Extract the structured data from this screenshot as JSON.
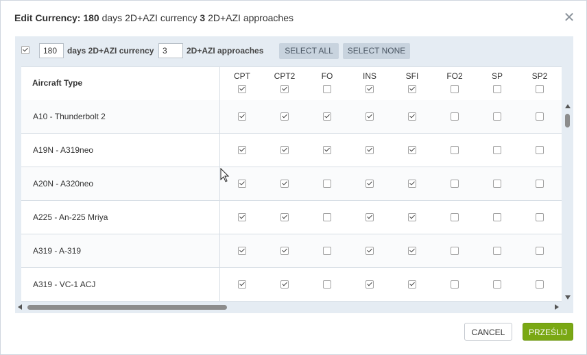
{
  "dialog": {
    "title_prefix": "Edit Currency:",
    "title_days": "180",
    "title_mid": "days 2D+AZI currency",
    "title_approaches": "3",
    "title_suffix": "2D+AZI approaches"
  },
  "toolbar": {
    "days_value": "180",
    "days_label": "days 2D+AZI currency",
    "approaches_value": "3",
    "approaches_label": "2D+AZI approaches",
    "select_all": "SELECT ALL",
    "select_none": "SELECT NONE"
  },
  "table": {
    "type_header": "Aircraft Type",
    "columns": [
      {
        "label": "CPT",
        "checked": true
      },
      {
        "label": "CPT2",
        "checked": true
      },
      {
        "label": "FO",
        "checked": false
      },
      {
        "label": "INS",
        "checked": true
      },
      {
        "label": "SFI",
        "checked": true
      },
      {
        "label": "FO2",
        "checked": false
      },
      {
        "label": "SP",
        "checked": false
      },
      {
        "label": "SP2",
        "checked": false
      }
    ],
    "rows": [
      {
        "name": "A10 - Thunderbolt 2",
        "checks": [
          true,
          true,
          true,
          true,
          true,
          false,
          false,
          false
        ]
      },
      {
        "name": "A19N - A319neo",
        "checks": [
          true,
          true,
          true,
          true,
          true,
          false,
          false,
          false
        ]
      },
      {
        "name": "A20N - A320neo",
        "checks": [
          true,
          true,
          false,
          true,
          true,
          false,
          false,
          false
        ]
      },
      {
        "name": "A225 - An-225 Mriya",
        "checks": [
          true,
          true,
          false,
          true,
          true,
          false,
          false,
          false
        ]
      },
      {
        "name": "A319 - A-319",
        "checks": [
          true,
          true,
          false,
          true,
          true,
          false,
          false,
          false
        ]
      },
      {
        "name": "A319 - VC-1 ACJ",
        "checks": [
          true,
          true,
          false,
          true,
          true,
          false,
          false,
          false
        ]
      }
    ]
  },
  "footer": {
    "cancel": "CANCEL",
    "submit": "PRZEŚLIJ"
  },
  "colors": {
    "accent_green": "#7aa814",
    "panel_bg": "#e5ecf3",
    "button_grey": "#c8d3de"
  }
}
